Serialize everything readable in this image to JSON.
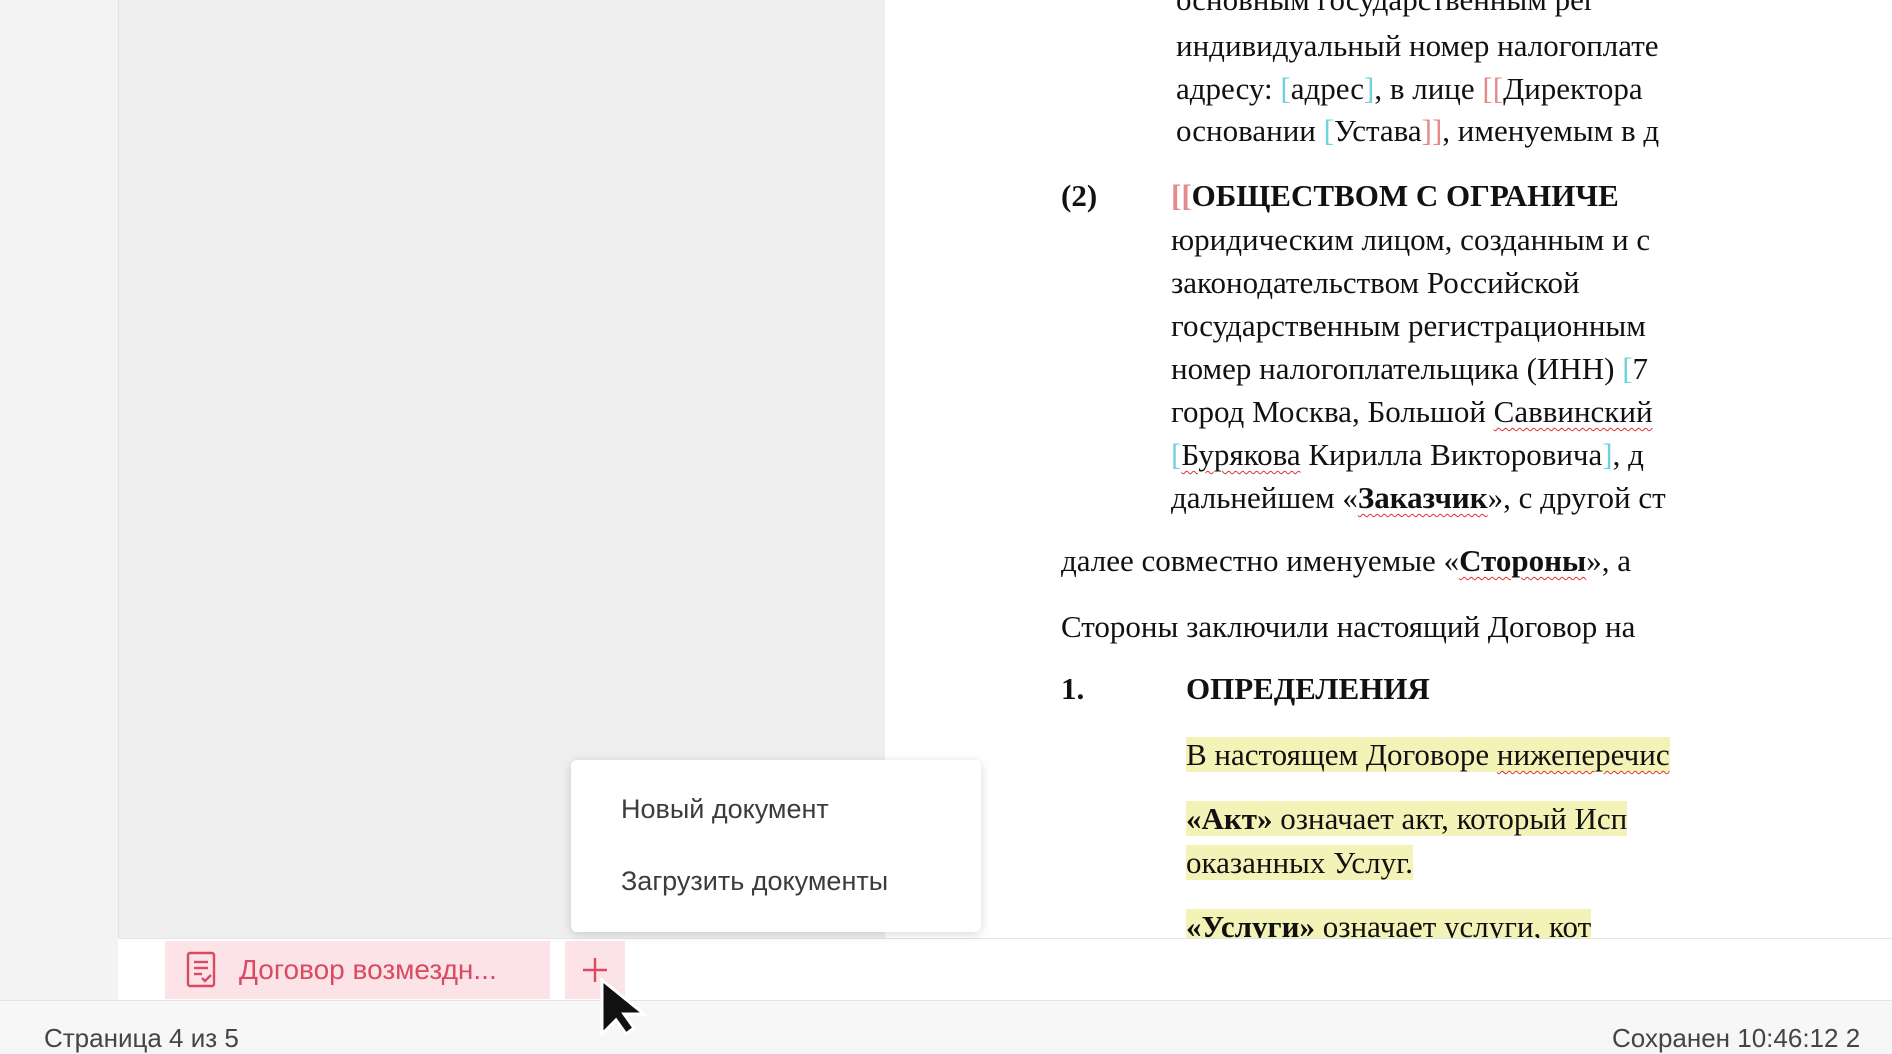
{
  "document": {
    "lines": [
      {
        "pre": "основным   государственным   рег"
      },
      {
        "pre": "индивидуальный номер налогоплате"
      },
      {
        "pre": "адресу: ",
        "b1": "[",
        "mid": "адрес",
        "b2": "]",
        "post": ", в лице ",
        "b3": "[[",
        "tail": "Директора"
      },
      {
        "pre": "основании ",
        "b1": "[",
        "mid": "Устава",
        "b2": "]]",
        "post": ", именуемым в д"
      }
    ],
    "party2_number": "(2)",
    "party2_lines": [
      {
        "bracket": "[[",
        "text": "ОБЩЕСТВОМ  С  ОГРАНИЧЕ"
      },
      {
        "text": "юридическим лицом, созданным и с"
      },
      {
        "text": "законодательством     Российской"
      },
      {
        "text": "государственным  регистрационным"
      },
      {
        "text": "номер налогоплательщика (ИНН) ",
        "bracket_end": "[",
        "tail": "7"
      },
      {
        "pre": "город Москва, Большой ",
        "wavy": "Саввинский"
      },
      {
        "bracket": "[",
        "wavy": "Бурякова",
        "post": " Кирилла Викторовича",
        "bracket_end": "]",
        "tail": ", д"
      },
      {
        "pre": "дальнейшем «",
        "bold": "Заказчик",
        "post2": "», с другой ст"
      }
    ],
    "joint_line": {
      "pre": "далее совместно именуемые «",
      "bold": "Стороны",
      "post": "», а"
    },
    "concluded_line": "Стороны заключили настоящий Договор на",
    "section_number": "1.",
    "section_title": "ОПРЕДЕЛЕНИЯ",
    "definitions_intro": {
      "pre": "В настоящем Договоре ",
      "wavy": "нижеперечис"
    },
    "act_line1": {
      "bold": "«Акт»",
      "post": " означает акт, который Исп"
    },
    "act_line2": "оказанных Услуг.",
    "services_line": {
      "bold": "«Услуги»",
      "post": "   означает   услуги,   кот"
    }
  },
  "tabbar": {
    "doc_tab_label": "Договор возмездн...",
    "doc_tab_icon": "document-icon",
    "add_icon": "plus-icon"
  },
  "menu": {
    "items": [
      "Новый документ",
      "Загрузить документы"
    ]
  },
  "status": {
    "page": "Страница 4 из 5",
    "saved": "Сохранен 10:46:12 2"
  },
  "colors": {
    "accent": "#d94a63",
    "tab_bg": "#fbe3e7",
    "highlight": "#f3f3b8",
    "bracket_cyan": "#6fd3da",
    "bracket_red": "#e58a8a"
  }
}
